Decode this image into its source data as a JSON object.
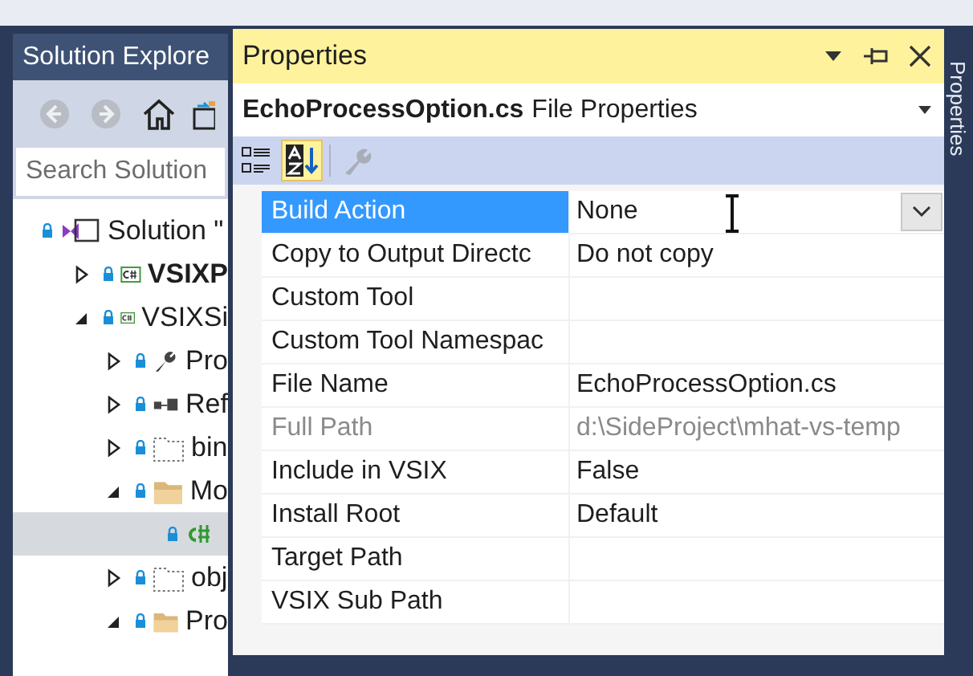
{
  "solution_explorer": {
    "title": "Solution Explore",
    "search": {
      "placeholder": "Search Solution"
    },
    "toolbar": [
      {
        "kind": "back",
        "disabled": true
      },
      {
        "kind": "forward",
        "disabled": true
      },
      {
        "kind": "home",
        "disabled": false
      },
      {
        "kind": "sync",
        "disabled": false
      }
    ],
    "tree": [
      {
        "label": "Solution \"",
        "kind": "solution",
        "bold": false,
        "selected": false,
        "children": [
          {
            "label": "VSIXP",
            "kind": "csproj",
            "bold": true,
            "selected": false,
            "expanded": false
          },
          {
            "label": "VSIXSi",
            "kind": "csproj",
            "bold": false,
            "selected": false,
            "expanded": true,
            "children": [
              {
                "label": "Pro",
                "kind": "wrench",
                "bold": false,
                "selected": false,
                "expanded": false
              },
              {
                "label": "Ref",
                "kind": "references",
                "bold": false,
                "selected": false,
                "expanded": false
              },
              {
                "label": "bin",
                "kind": "hidden-folder",
                "bold": false,
                "selected": false,
                "expanded": false
              },
              {
                "label": "Mo",
                "kind": "folder",
                "bold": false,
                "selected": false,
                "expanded": true,
                "children": [
                  {
                    "kind": "csfile",
                    "selected": true
                  }
                ]
              },
              {
                "label": "obj",
                "kind": "hidden-folder",
                "bold": false,
                "selected": false,
                "expanded": false
              },
              {
                "label": "Pro",
                "kind": "folder",
                "bold": false,
                "selected": false,
                "expanded": true
              }
            ]
          }
        ]
      }
    ]
  },
  "properties": {
    "title": "Properties",
    "object_name": "EchoProcessOption.cs",
    "object_type": "File Properties",
    "toolbar": [
      {
        "kind": "categorized",
        "selected": false,
        "disabled": false
      },
      {
        "kind": "alphabetical",
        "selected": true,
        "disabled": false
      },
      {
        "kind": "property-pages",
        "selected": false,
        "disabled": true
      }
    ],
    "rows": [
      {
        "name": "Build Action",
        "value": "None",
        "kind": "dropdown",
        "selected": true,
        "disabled": false
      },
      {
        "name": "Copy to Output Directc",
        "value": "Do not copy",
        "kind": "text",
        "selected": false,
        "disabled": false
      },
      {
        "name": "Custom Tool",
        "kind": "text",
        "selected": false,
        "disabled": false
      },
      {
        "name": "Custom Tool Namespac",
        "kind": "text",
        "selected": false,
        "disabled": false
      },
      {
        "name": "File Name",
        "value": "EchoProcessOption.cs",
        "kind": "text",
        "selected": false,
        "disabled": false
      },
      {
        "name": "Full Path",
        "value": "d:\\SideProject\\mhat-vs-temp",
        "kind": "text",
        "selected": false,
        "disabled": true
      },
      {
        "name": "Include in VSIX",
        "value": "False",
        "kind": "text",
        "selected": false,
        "disabled": false
      },
      {
        "name": "Install Root",
        "value": "Default",
        "kind": "text",
        "selected": false,
        "disabled": false
      },
      {
        "name": "Target Path",
        "kind": "text",
        "selected": false,
        "disabled": false
      },
      {
        "name": "VSIX Sub Path",
        "kind": "text",
        "selected": false,
        "disabled": false
      }
    ]
  },
  "side_tab": {
    "label": "Properties"
  }
}
